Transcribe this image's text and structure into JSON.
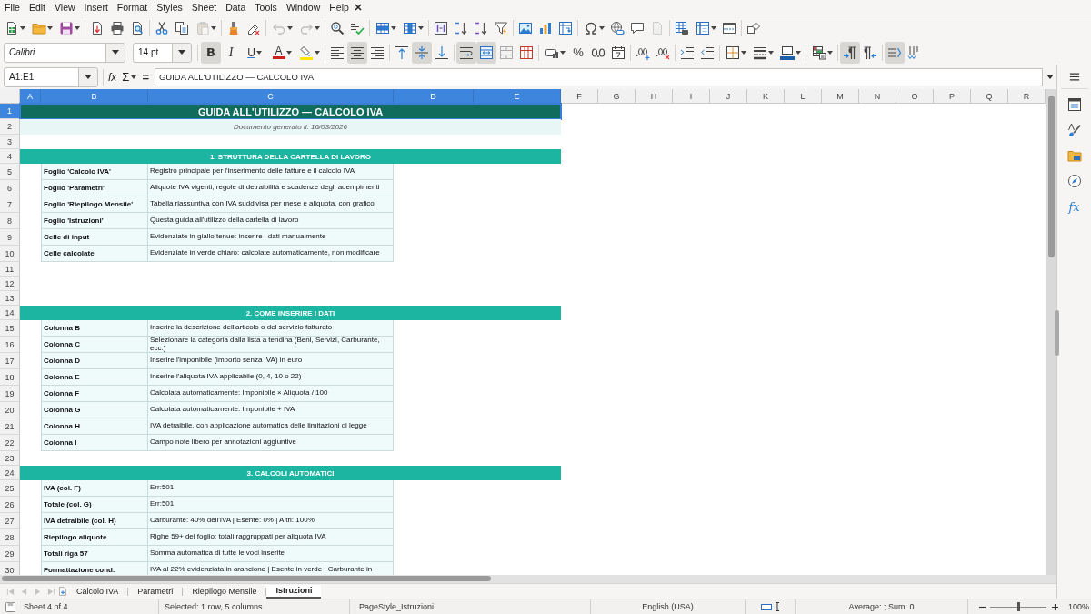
{
  "menu": [
    "File",
    "Edit",
    "View",
    "Insert",
    "Format",
    "Styles",
    "Sheet",
    "Data",
    "Tools",
    "Window",
    "Help"
  ],
  "standard_toolbar": [
    {
      "disabled": false
    },
    {
      "disabled": false
    },
    {
      "disabled": false
    },
    {
      "disabled": false
    },
    {
      "disabled": false
    },
    {
      "disabled": false
    },
    {
      "disabled": false
    },
    {
      "disabled": false
    },
    {
      "disabled": true
    },
    {
      "disabled": false
    },
    {
      "disabled": false
    },
    {
      "disabled": true
    },
    {
      "disabled": true
    },
    {
      "disabled": false
    },
    {
      "disabled": false
    },
    {
      "disabled": false
    },
    {
      "disabled": false
    },
    {
      "disabled": false
    },
    {
      "disabled": false
    },
    {
      "disabled": false
    },
    {
      "disabled": false
    },
    {
      "disabled": false
    },
    {
      "disabled": false
    },
    {
      "disabled": false
    },
    {
      "disabled": false
    },
    {
      "disabled": false
    },
    {
      "disabled": false
    },
    {
      "disabled": true
    },
    {
      "disabled": false
    },
    {
      "disabled": false
    },
    {
      "disabled": false
    },
    {
      "disabled": false
    }
  ],
  "formatting_toolbar": {
    "font_name": "Calibri",
    "font_size": "14 pt",
    "buttons": [
      {
        "label": "B",
        "on": true
      },
      {
        "label": "I",
        "on": false
      },
      {
        "label": "U",
        "on": false
      },
      {
        "label": "A",
        "on": false
      },
      {
        "on": false
      },
      {
        "on": false
      },
      {
        "on": true
      },
      {
        "on": false
      },
      {
        "on": false
      },
      {
        "on": true
      },
      {
        "on": false
      },
      {
        "on": true
      },
      {
        "on": true
      },
      {
        "on": false
      },
      {
        "on": false
      },
      {
        "on": false
      },
      {
        "label": "%",
        "on": false
      },
      {
        "on": false
      },
      {
        "on": false
      },
      {
        "on": false
      },
      {
        "on": false
      },
      {
        "on": false
      },
      {
        "on": false
      },
      {
        "on": false
      },
      {
        "on": false
      },
      {
        "on": false
      },
      {
        "on": false
      },
      {
        "on": true
      },
      {
        "on": false
      },
      {
        "on": true
      },
      {
        "on": false
      }
    ]
  },
  "formula_bar": {
    "cell_reference": "A1:E1",
    "function_wizard": "fx",
    "sum": "Σ",
    "formula": "=",
    "content": "GUIDA ALL'UTILIZZO — CALCOLO IVA"
  },
  "sheet": {
    "columns": [
      {
        "label": "A",
        "selected": true
      },
      {
        "label": "B",
        "selected": true
      },
      {
        "label": "C",
        "selected": true
      },
      {
        "label": "D",
        "selected": true
      },
      {
        "label": "E",
        "selected": true
      },
      {
        "label": "F",
        "selected": false
      },
      {
        "label": "G",
        "selected": false
      },
      {
        "label": "H",
        "selected": false
      },
      {
        "label": "I",
        "selected": false
      },
      {
        "label": "J",
        "selected": false
      },
      {
        "label": "K",
        "selected": false
      },
      {
        "label": "L",
        "selected": false
      },
      {
        "label": "M",
        "selected": false
      },
      {
        "label": "N",
        "selected": false
      },
      {
        "label": "O",
        "selected": false
      },
      {
        "label": "P",
        "selected": false
      },
      {
        "label": "Q",
        "selected": false
      },
      {
        "label": "R",
        "selected": false
      }
    ],
    "rows": [
      {
        "number": "1",
        "selected": true,
        "kind": "title",
        "text": "GUIDA ALL'UTILIZZO — CALCOLO IVA"
      },
      {
        "number": "2",
        "selected": false,
        "kind": "note",
        "text": "Documento generato il: 16/03/2026"
      },
      {
        "number": "3",
        "selected": false,
        "kind": "empty"
      },
      {
        "number": "4",
        "selected": false,
        "kind": "heading",
        "text": "1. STRUTTURA DELLA CARTELLA DI LAVORO"
      },
      {
        "number": "5",
        "selected": false,
        "kind": "entry",
        "label": "Foglio 'Calcolo IVA'",
        "text": "Registro principale per l'inserimento delle fatture e il calcolo IVA"
      },
      {
        "number": "6",
        "selected": false,
        "kind": "entry",
        "label": "Foglio 'Parametri'",
        "text": "Aliquote IVA vigenti, regole di detraibilità e scadenze degli adempimenti"
      },
      {
        "number": "7",
        "selected": false,
        "kind": "entry",
        "label": "Foglio 'Riepilogo Mensile'",
        "text": "Tabella riassuntiva con IVA suddivisa per mese e aliquota, con grafico"
      },
      {
        "number": "8",
        "selected": false,
        "kind": "entry",
        "label": "Foglio 'Istruzioni'",
        "text": "Questa guida all'utilizzo della cartella di lavoro"
      },
      {
        "number": "9",
        "selected": false,
        "kind": "entry",
        "label": "Celle di input",
        "text": "Evidenziate in giallo tenue: inserire i dati manualmente"
      },
      {
        "number": "10",
        "selected": false,
        "kind": "entry",
        "label": "Celle calcolate",
        "text": "Evidenziate in verde chiaro: calcolate automaticamente, non modificare"
      },
      {
        "number": "11",
        "selected": false,
        "kind": "empty"
      },
      {
        "number": "12",
        "selected": false,
        "kind": "empty"
      },
      {
        "number": "13",
        "selected": false,
        "kind": "empty"
      },
      {
        "number": "14",
        "selected": false,
        "kind": "heading",
        "text": "2. COME INSERIRE I DATI"
      },
      {
        "number": "15",
        "selected": false,
        "kind": "entry",
        "label": "Colonna B",
        "text": "Inserire la descrizione dell'articolo o del servizio fatturato"
      },
      {
        "number": "16",
        "selected": false,
        "kind": "entry",
        "label": "Colonna C",
        "text": "Selezionare la categoria dalla lista a tendina (Beni, Servizi, Carburante, ecc.)"
      },
      {
        "number": "17",
        "selected": false,
        "kind": "entry",
        "label": "Colonna D",
        "text": "Inserire l'imponibile (importo senza IVA) in euro"
      },
      {
        "number": "18",
        "selected": false,
        "kind": "entry",
        "label": "Colonna E",
        "text": "Inserire l'aliquota IVA applicabile (0, 4, 10 o 22)"
      },
      {
        "number": "19",
        "selected": false,
        "kind": "entry",
        "label": "Colonna F",
        "text": "Calcolata automaticamente: Imponibile × Aliquota / 100"
      },
      {
        "number": "20",
        "selected": false,
        "kind": "entry",
        "label": "Colonna G",
        "text": "Calcolata automaticamente: Imponibile + IVA"
      },
      {
        "number": "21",
        "selected": false,
        "kind": "entry",
        "label": "Colonna H",
        "text": "IVA detraibile, con applicazione automatica delle limitazioni di legge"
      },
      {
        "number": "22",
        "selected": false,
        "kind": "entry",
        "label": "Colonna I",
        "text": "Campo note libero per annotazioni aggiuntive"
      },
      {
        "number": "23",
        "selected": false,
        "kind": "empty"
      },
      {
        "number": "24",
        "selected": false,
        "kind": "heading",
        "text": "3. CALCOLI AUTOMATICI"
      },
      {
        "number": "25",
        "selected": false,
        "kind": "entry",
        "label": "IVA (col. F)",
        "text": "Err:501"
      },
      {
        "number": "26",
        "selected": false,
        "kind": "entry",
        "label": "Totale (col. G)",
        "text": "Err:501"
      },
      {
        "number": "27",
        "selected": false,
        "kind": "entry",
        "label": "IVA detraibile (col. H)",
        "text": "Carburante: 40% dell'IVA | Esente: 0% | Altri: 100%"
      },
      {
        "number": "28",
        "selected": false,
        "kind": "entry",
        "label": "Riepilogo aliquote",
        "text": "Righe 59+ del foglio: totali raggruppati per aliquota IVA"
      },
      {
        "number": "29",
        "selected": false,
        "kind": "entry",
        "label": "Totali riga 57",
        "text": "Somma automatica di tutte le voci inserite"
      },
      {
        "number": "30",
        "selected": false,
        "kind": "entry",
        "label": "Formattazione cond.",
        "text": "IVA al 22% evidenziata in arancione | Esente in verde | Carburante in"
      }
    ]
  },
  "sheet_navigation": [
    {
      "disabled": true
    },
    {
      "disabled": true
    },
    {
      "disabled": true
    },
    {
      "disabled": true
    }
  ],
  "sheet_tabs": [
    {
      "label": "Calcolo IVA",
      "selected": false
    },
    {
      "label": "Parametri",
      "selected": false
    },
    {
      "label": "Riepilogo Mensile",
      "selected": false
    },
    {
      "label": "Istruzioni",
      "selected": true
    }
  ],
  "sidebar": {
    "decks": [
      {
        "selected": false
      },
      {
        "selected": false
      },
      {
        "selected": false
      },
      {
        "selected": false
      },
      {
        "label": "fx",
        "selected": false
      }
    ]
  },
  "status_bar": {
    "sheet": "Sheet 4 of 4",
    "selection": "Selected: 1 row, 5 columns",
    "page_style": "PageStyle_Istruzioni",
    "language": "English (USA)",
    "statistics": "Average: ; Sum: 0",
    "zoom_slider": {
      "level": 0.5
    },
    "zoom": "100%"
  }
}
